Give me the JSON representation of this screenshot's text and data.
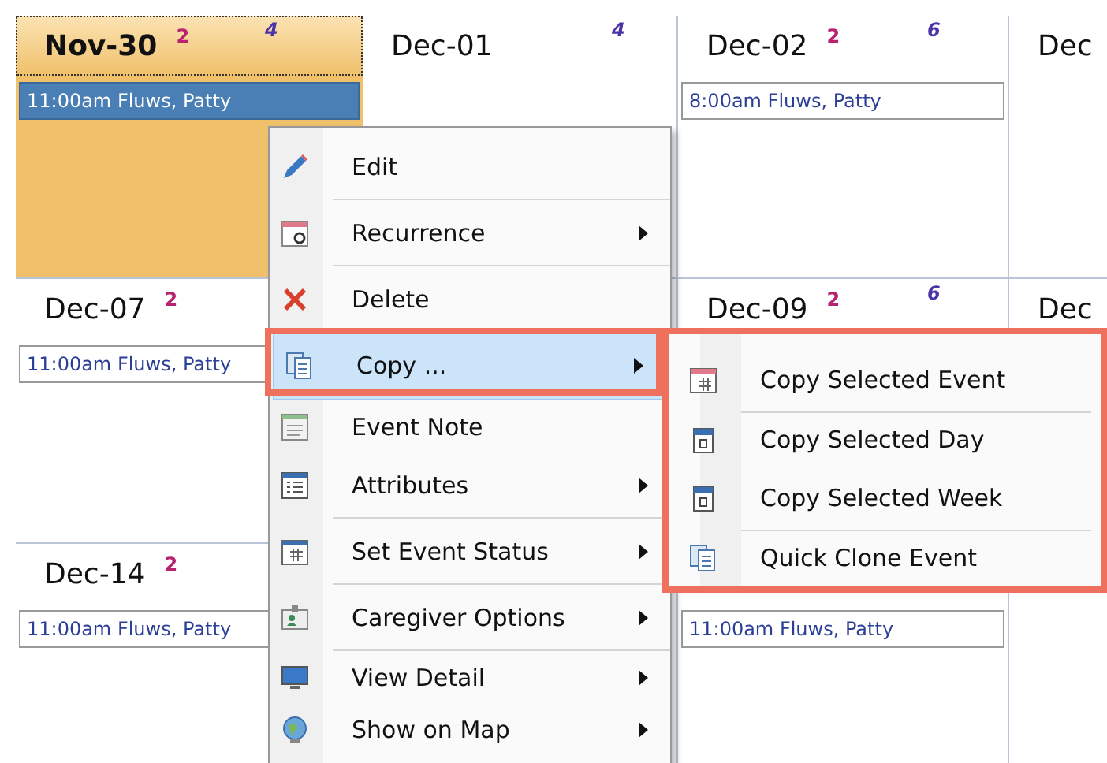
{
  "calendar": {
    "weeks": [
      {
        "column_1": {
          "date": "Nov-30",
          "selected": true,
          "count_a": "2",
          "count_b": "4",
          "events": [
            {
              "text": "11:00am Fluws, Patty",
              "selected": true
            }
          ]
        },
        "column_2": {
          "date": "Dec-01",
          "selected": false,
          "count_b": "4"
        },
        "column_3": {
          "date": "Dec-02",
          "selected": false,
          "count_a": "2",
          "count_b": "6",
          "events": [
            {
              "text": "8:00am Fluws, Patty",
              "selected": false
            }
          ]
        },
        "column_4": {
          "date": "Dec",
          "selected": false
        }
      },
      {
        "column_1": {
          "date": "Dec-07",
          "selected": false,
          "count_a": "2",
          "events": [
            {
              "text": "11:00am Fluws, Patty",
              "selected": false
            }
          ]
        },
        "column_3": {
          "date": "Dec-09",
          "selected": false,
          "count_a": "2",
          "count_b": "6"
        },
        "column_4": {
          "date": "Dec",
          "selected": false
        }
      },
      {
        "column_1": {
          "date": "Dec-14",
          "selected": false,
          "count_a": "2",
          "events": [
            {
              "text": "11:00am Fluws, Patty",
              "selected": false
            }
          ]
        },
        "column_3": {
          "events": [
            {
              "text": "11:00am Fluws, Patty",
              "selected": false
            }
          ]
        }
      }
    ]
  },
  "context_menu": {
    "items": [
      {
        "label": "Edit",
        "submenu": false,
        "selected": false,
        "separator_after": true
      },
      {
        "label": "Recurrence",
        "submenu": true,
        "selected": false,
        "separator_after": true
      },
      {
        "label": "Delete",
        "submenu": false,
        "selected": false,
        "separator_after": true
      },
      {
        "label": "Copy ...",
        "submenu": true,
        "selected": true,
        "separator_after": true,
        "highlighted": true,
        "children": [
          {
            "label": "Copy Selected Event",
            "separator_after": true
          },
          {
            "label": "Copy Selected Day",
            "separator_after": false
          },
          {
            "label": "Copy Selected Week",
            "separator_after": true
          },
          {
            "label": "Quick Clone Event",
            "separator_after": false
          }
        ]
      },
      {
        "label": "Event Note",
        "submenu": false,
        "selected": false,
        "separator_after": false
      },
      {
        "label": "Attributes",
        "submenu": true,
        "selected": false,
        "separator_after": true
      },
      {
        "label": "Set Event Status",
        "submenu": true,
        "selected": false,
        "separator_after": true
      },
      {
        "label": "Caregiver Options",
        "submenu": true,
        "selected": false,
        "separator_after": true
      },
      {
        "label": "View Detail",
        "submenu": true,
        "selected": false,
        "separator_after": false
      },
      {
        "label": "Show on Map",
        "submenu": true,
        "selected": false,
        "separator_after": false
      }
    ]
  }
}
